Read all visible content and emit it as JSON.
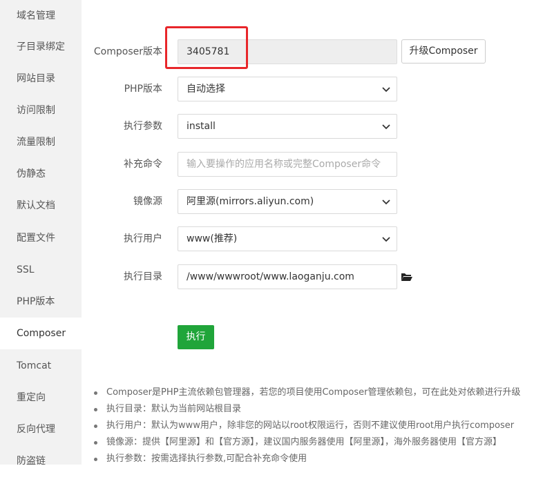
{
  "sidebar": {
    "items": [
      {
        "label": "域名管理"
      },
      {
        "label": "子目录绑定"
      },
      {
        "label": "网站目录"
      },
      {
        "label": "访问限制"
      },
      {
        "label": "流量限制"
      },
      {
        "label": "伪静态"
      },
      {
        "label": "默认文档"
      },
      {
        "label": "配置文件"
      },
      {
        "label": "SSL"
      },
      {
        "label": "PHP版本"
      },
      {
        "label": "Composer"
      },
      {
        "label": "Tomcat"
      },
      {
        "label": "重定向"
      },
      {
        "label": "反向代理"
      },
      {
        "label": "防盗链"
      }
    ],
    "active": "Composer"
  },
  "form": {
    "composer_version": {
      "label": "Composer版本",
      "value": "3405781"
    },
    "upgrade_button": "升级Composer",
    "php_version": {
      "label": "PHP版本",
      "value": "自动选择"
    },
    "exec_params": {
      "label": "执行参数",
      "value": "install"
    },
    "extra_command": {
      "label": "补充命令",
      "placeholder": "输入要操作的应用名称或完整Composer命令"
    },
    "mirror": {
      "label": "镜像源",
      "value": "阿里源(mirrors.aliyun.com)"
    },
    "exec_user": {
      "label": "执行用户",
      "value": "www(推荐)"
    },
    "exec_dir": {
      "label": "执行目录",
      "value": "/www/wwwroot/www.laoganju.com"
    },
    "run_button": "执行"
  },
  "notes": [
    "Composer是PHP主流依赖包管理器，若您的项目使用Composer管理依赖包，可在此处对依赖进行升级",
    "执行目录：默认为当前网站根目录",
    "执行用户：默认为www用户，除非您的网站以root权限运行，否则不建议使用root用户执行composer",
    "镜像源：提供【阿里源】和【官方源】，建议国内服务器使用【阿里源】，海外服务器使用【官方源】",
    "执行参数：按需选择执行参数,可配合补充命令使用"
  ],
  "colors": {
    "accent_green": "#20a53a",
    "highlight_red": "#e8262a",
    "sidebar_bg": "#f2f2f2"
  }
}
